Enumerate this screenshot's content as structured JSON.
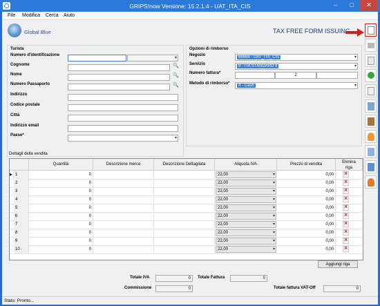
{
  "window": {
    "title": "GRIPS!now Versione: 15.2.1.4 - UAT_ITA_CIS",
    "minimize": "–",
    "maximize": "□",
    "close": "✕"
  },
  "menu": [
    "File",
    "Modifica",
    "Cerca",
    "Aiuto"
  ],
  "logo_text": "Global Blue",
  "tax_free_heading": "TAX FREE FORM ISSUING",
  "tourist": {
    "section_label": "Turista",
    "fields": [
      {
        "label": "Numero d'identificazione",
        "value": ""
      },
      {
        "label": "Cognome",
        "value": ""
      },
      {
        "label": "Nome",
        "value": ""
      },
      {
        "label": "Numero Passaporto",
        "value": ""
      },
      {
        "label": "Indirizzo",
        "value": ""
      },
      {
        "label": "Codice postale",
        "value": ""
      },
      {
        "label": "Città",
        "value": ""
      },
      {
        "label": "Indirizzo email",
        "value": ""
      },
      {
        "label": "Paese*",
        "value": ""
      }
    ]
  },
  "refund": {
    "section_label": "Opzioni di rimborso",
    "negozio_label": "Negozio",
    "negozio_value": "66666 - UAT_ITA_CIS",
    "servizio_label": "Servizio",
    "servizio_value": "9 - ITA STANDARD 8",
    "fattura_label": "Numero fattura*",
    "fattura_value": "2",
    "metodo_label": "Metodo di rimborso*",
    "metodo_value": "4 - Cash"
  },
  "sales": {
    "section_label": "Dettagli della vendita",
    "columns": [
      "Quantità",
      "Descrizione merce",
      "Descrizione Dettagliata",
      "Aliquota IVA",
      "Prezzo di vendita",
      "Elimina riga"
    ],
    "rows": [
      {
        "n": "1",
        "qty": "0",
        "iva": "22,00",
        "price": "0,00"
      },
      {
        "n": "2",
        "qty": "0",
        "iva": "22,00",
        "price": "0,00"
      },
      {
        "n": "3",
        "qty": "0",
        "iva": "22,00",
        "price": "0,00"
      },
      {
        "n": "4",
        "qty": "0",
        "iva": "22,00",
        "price": "0,00"
      },
      {
        "n": "5",
        "qty": "0",
        "iva": "22,00",
        "price": "0,00"
      },
      {
        "n": "6",
        "qty": "0",
        "iva": "22,00",
        "price": "0,00"
      },
      {
        "n": "7",
        "qty": "0",
        "iva": "22,00",
        "price": "0,00"
      },
      {
        "n": "8",
        "qty": "0",
        "iva": "22,00",
        "price": "0,00"
      },
      {
        "n": "9",
        "qty": "0",
        "iva": "22,00",
        "price": "0,00"
      },
      {
        "n": "10",
        "qty": "0",
        "iva": "22,00",
        "price": "0,00"
      }
    ],
    "add_row_button": "Aggiungi riga"
  },
  "totals": {
    "totale_iva_label": "Totale IVA",
    "totale_iva_value": "0",
    "totale_fattura_label": "Totale Fattura",
    "totale_fattura_value": "0",
    "commissione_label": "Commissione",
    "commissione_value": "0",
    "vat_off_label": "Totale fattura VAT-Off",
    "vat_off_value": "0"
  },
  "status": "Stato: Pronto...",
  "colors": {
    "accent": "#2b79d8",
    "selection": "#3c7fd2",
    "delete": "#d4261f"
  },
  "sidebar_icons": [
    "new-form-icon",
    "print-icon",
    "edit-icon",
    "refresh-icon",
    "document-icon",
    "copy-icon",
    "stamp-icon",
    "user-icon",
    "search-user-icon",
    "sync-icon",
    "user-manage-icon"
  ]
}
